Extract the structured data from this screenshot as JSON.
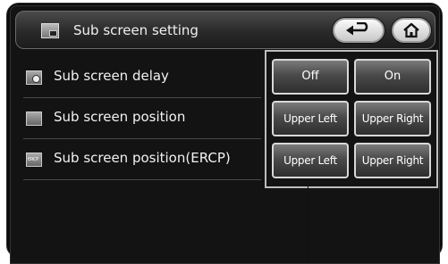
{
  "header": {
    "title": "Sub screen setting",
    "icon": "monitor-icon",
    "back_icon": "back-arrow-icon",
    "home_icon": "home-icon"
  },
  "rows": [
    {
      "label": "Sub screen delay",
      "icon": "sub-screen-delay-icon",
      "options": [
        "Off",
        "On"
      ]
    },
    {
      "label": "Sub screen position",
      "icon": "sub-screen-position-icon",
      "options": [
        "Upper Left",
        "Upper Right"
      ]
    },
    {
      "label": "Sub screen position(ERCP)",
      "icon": "sub-screen-ercp-icon",
      "options": [
        "Upper Left",
        "Upper Right"
      ]
    }
  ],
  "colors": {
    "background": "#131313",
    "text": "#f2f2f2",
    "button_border": "#d8d8d8"
  }
}
